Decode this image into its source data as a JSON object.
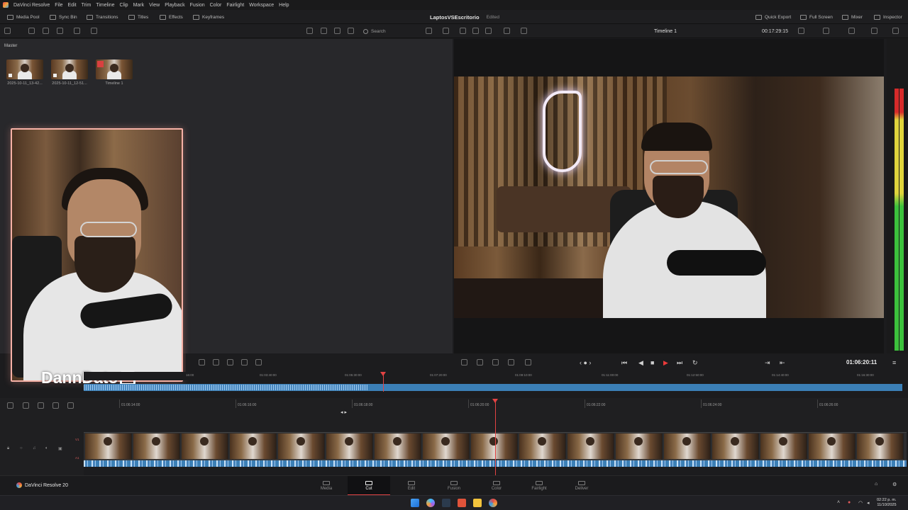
{
  "app": {
    "name": "DaVinci Resolve",
    "menus": [
      "File",
      "Edit",
      "Trim",
      "Timeline",
      "Clip",
      "Mark",
      "View",
      "Playback",
      "Fusion",
      "Color",
      "Fairlight",
      "Workspace",
      "Help"
    ]
  },
  "toolbar": {
    "left": [
      "Media Pool",
      "Sync Bin",
      "Transitions",
      "Titles",
      "Effects",
      "Keyframes"
    ],
    "project_name": "LaptosVSEscritorio",
    "project_status": "Edited",
    "right": [
      "Quick Export",
      "Full Screen",
      "Mixer",
      "Inspector"
    ]
  },
  "subbar": {
    "search_placeholder": "Search",
    "timeline_name": "Timeline 1",
    "duration": "00:17:29:15"
  },
  "media_pool": {
    "title": "Master",
    "clips": [
      {
        "label": "2025-10-11_13-42..."
      },
      {
        "label": "2025-10-11_12-51..."
      },
      {
        "label": "Timeline 1"
      }
    ]
  },
  "overlay": {
    "watermark": "DannDato"
  },
  "viewer": {
    "timecode": "01:06:20:11"
  },
  "timeline": {
    "ruler_upper": [
      "01:03:40:00",
      "01:05:30:00",
      "01:07:20:00",
      "01:09:10:00",
      "01:11:00:00",
      "01:12:50:00",
      "01:14:40:00",
      "01:16:30:00"
    ],
    "ruler_upper_start": "16:00",
    "ruler_lower": [
      "01:06:14:00",
      "01:06:16:00",
      "01:06:18:00",
      "01:06:20:00",
      "01:06:22:00",
      "01:06:24:00",
      "01:06:26:00"
    ],
    "track_video": "V1",
    "track_audio": "A1"
  },
  "pages": {
    "brand": "DaVinci Resolve 20",
    "tabs": [
      "Media",
      "Cut",
      "Edit",
      "Fusion",
      "Color",
      "Fairlight",
      "Deliver"
    ],
    "active": "Cut"
  },
  "taskbar": {
    "time": "02:22 p. m.",
    "date": "11/10/2025"
  },
  "colors": {
    "accent": "#e34343",
    "cam_border": "#f6b1a6",
    "audio_clip": "#3b7fb6"
  }
}
